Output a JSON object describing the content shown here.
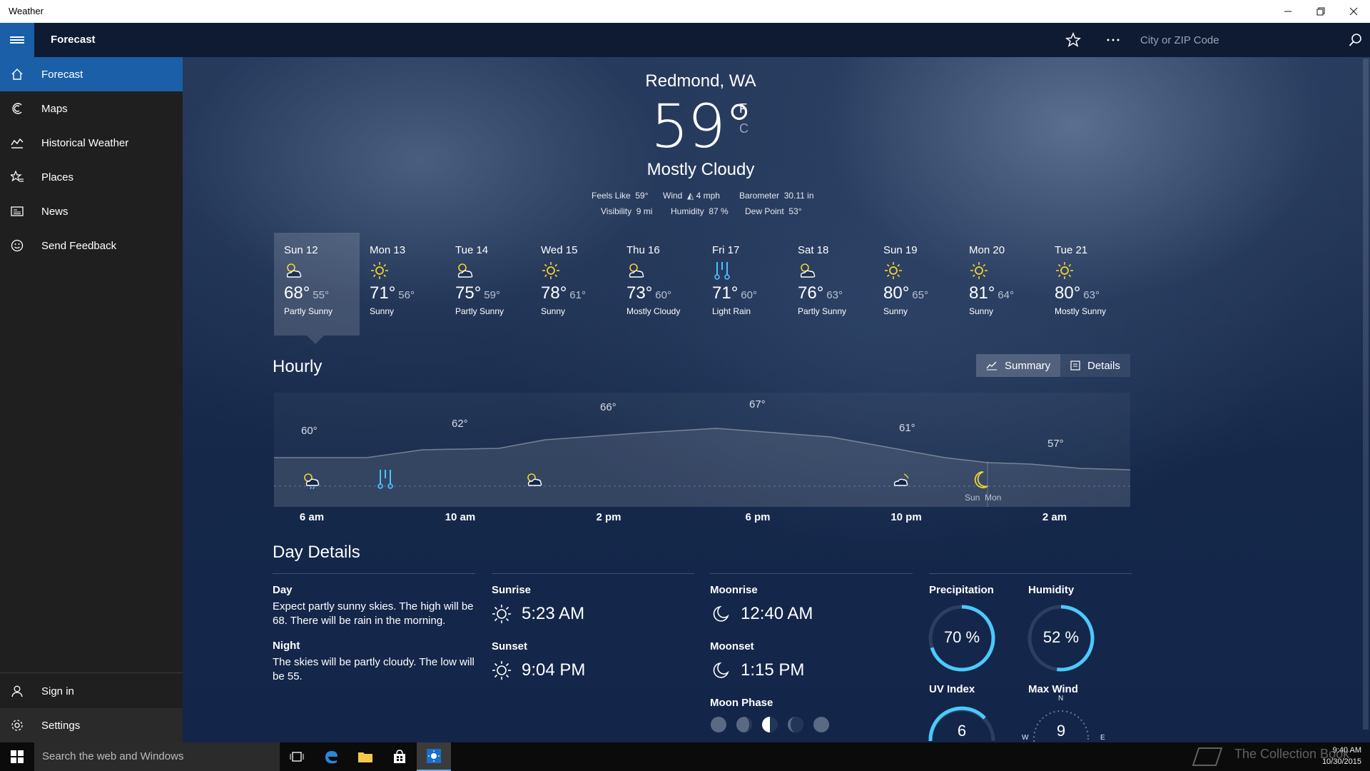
{
  "window": {
    "title": "Weather"
  },
  "header": {
    "title": "Forecast",
    "search_placeholder": "City or ZIP Code"
  },
  "sidebar": {
    "items": [
      {
        "label": "Forecast",
        "icon": "home-icon"
      },
      {
        "label": "Maps",
        "icon": "maps-icon"
      },
      {
        "label": "Historical Weather",
        "icon": "chart-icon"
      },
      {
        "label": "Places",
        "icon": "star-list-icon"
      },
      {
        "label": "News",
        "icon": "news-icon"
      },
      {
        "label": "Send Feedback",
        "icon": "smiley-icon"
      }
    ],
    "bottom": [
      {
        "label": "Sign in",
        "icon": "person-icon"
      },
      {
        "label": "Settings",
        "icon": "gear-icon"
      }
    ]
  },
  "current": {
    "city": "Redmond, WA",
    "temp": "59°",
    "unit_f": "F",
    "unit_c": "C",
    "condition": "Mostly Cloudy",
    "feels_like_label": "Feels Like",
    "feels_like": "59°",
    "wind_label": "Wind",
    "wind": "4 mph",
    "barometer_label": "Barometer",
    "barometer": "30.11 in",
    "visibility_label": "Visibility",
    "visibility": "9 mi",
    "humidity_label": "Humidity",
    "humidity": "87 %",
    "dew_point_label": "Dew Point",
    "dew_point": "53°"
  },
  "daily": [
    {
      "day": "Sun 12",
      "high": "68°",
      "low": "55°",
      "cond": "Partly Sunny",
      "icon": "partly-sunny-icon"
    },
    {
      "day": "Mon 13",
      "high": "71°",
      "low": "56°",
      "cond": "Sunny",
      "icon": "sun-icon"
    },
    {
      "day": "Tue 14",
      "high": "75°",
      "low": "59°",
      "cond": "Partly Sunny",
      "icon": "partly-sunny-icon"
    },
    {
      "day": "Wed 15",
      "high": "78°",
      "low": "61°",
      "cond": "Sunny",
      "icon": "sun-icon"
    },
    {
      "day": "Thu 16",
      "high": "73°",
      "low": "60°",
      "cond": "Mostly Cloudy",
      "icon": "partly-sunny-icon"
    },
    {
      "day": "Fri 17",
      "high": "71°",
      "low": "60°",
      "cond": "Light Rain",
      "icon": "rain-icon"
    },
    {
      "day": "Sat 18",
      "high": "76°",
      "low": "63°",
      "cond": "Partly Sunny",
      "icon": "partly-sunny-icon"
    },
    {
      "day": "Sun 19",
      "high": "80°",
      "low": "65°",
      "cond": "Sunny",
      "icon": "sun-icon"
    },
    {
      "day": "Mon 20",
      "high": "81°",
      "low": "64°",
      "cond": "Sunny",
      "icon": "sun-icon"
    },
    {
      "day": "Tue 21",
      "high": "80°",
      "low": "63°",
      "cond": "Mostly Sunny",
      "icon": "sun-icon"
    }
  ],
  "hourly": {
    "title": "Hourly",
    "summary_label": "Summary",
    "details_label": "Details",
    "temp_labels": [
      "60°",
      "62°",
      "66°",
      "67°",
      "61°",
      "57°"
    ],
    "time_ticks": [
      "6 am",
      "10 am",
      "2 pm",
      "6 pm",
      "10 pm",
      "2 am"
    ],
    "day_split": [
      "Sun",
      "Mon"
    ]
  },
  "day_details": {
    "title": "Day Details",
    "day_label": "Day",
    "day_text": "Expect partly sunny skies. The high will be 68. There will be rain in the morning.",
    "night_label": "Night",
    "night_text": "The skies will be partly cloudy. The low will be 55.",
    "sunrise_label": "Sunrise",
    "sunrise": "5:23 AM",
    "sunset_label": "Sunset",
    "sunset": "9:04 PM",
    "moonrise_label": "Moonrise",
    "moonrise": "12:40 AM",
    "moonset_label": "Moonset",
    "moonset": "1:15 PM",
    "moon_phase_label": "Moon Phase",
    "precip_label": "Precipitation",
    "precip": "70 %",
    "precip_fraction": 0.7,
    "humidity_label": "Humidity",
    "humidity": "52 %",
    "humidity_fraction": 0.52,
    "uv_label": "UV Index",
    "uv": "6",
    "maxwind_label": "Max Wind",
    "maxwind": "9",
    "compass_n": "N",
    "compass_w": "W",
    "compass_e": "E"
  },
  "taskbar": {
    "search_placeholder": "Search the web and Windows",
    "time": "9:40 AM",
    "date": "10/30/2015",
    "watermark": "The Collection Book"
  },
  "colors": {
    "accent": "#1a5fa8",
    "sun": "#f6d32d",
    "rain": "#4cc3ff",
    "ring": "#4cc9ff"
  }
}
